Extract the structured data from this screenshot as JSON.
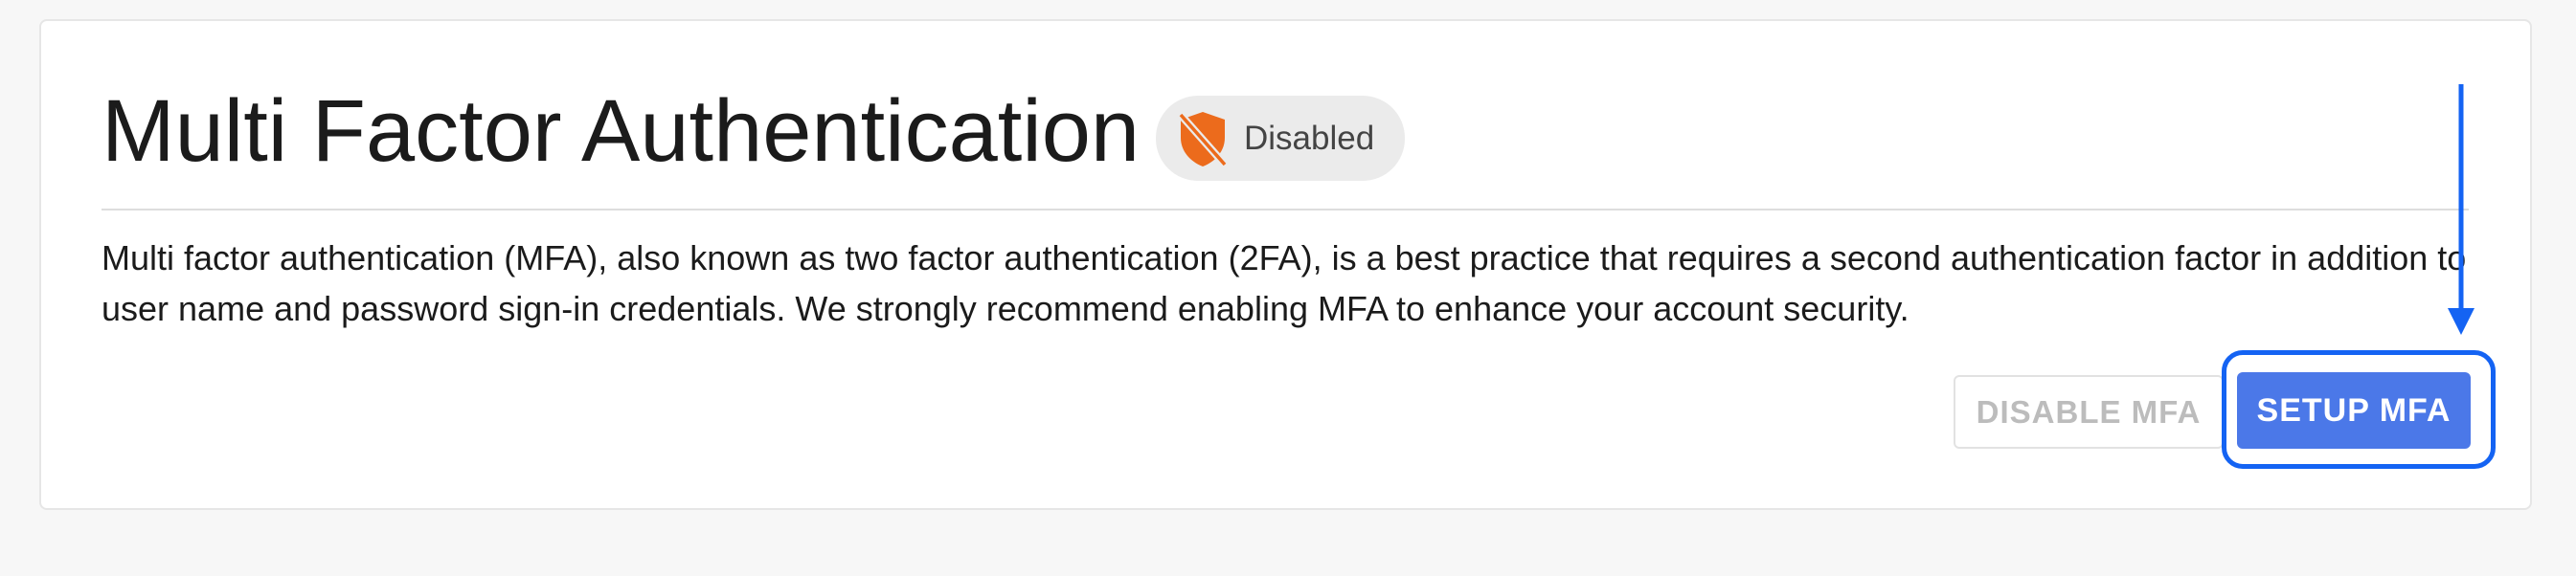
{
  "mfa": {
    "title": "Multi Factor Authentication",
    "status": {
      "label": "Disabled",
      "icon": "shield-off-icon",
      "color": "#ec6b1c"
    },
    "description": "Multi factor authentication (MFA), also known as two factor authentication (2FA), is a best practice that requires a second authentication factor in addition to user name and password sign-in credentials. We strongly recommend enabling MFA to enhance your account security.",
    "actions": {
      "disable_label": "DISABLE MFA",
      "setup_label": "SETUP MFA"
    }
  },
  "annotation": {
    "icon": "arrow-down-icon",
    "color": "#1463f3"
  },
  "colors": {
    "primary": "#4b78e8",
    "highlight": "#1463f3"
  }
}
